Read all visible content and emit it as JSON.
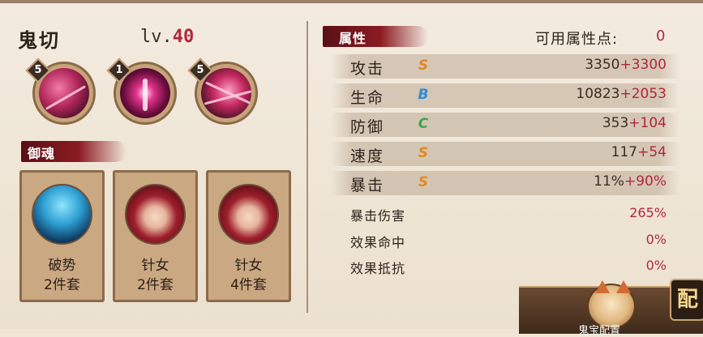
{
  "character": {
    "name": "鬼切",
    "level_prefix": "lv.",
    "level": "40"
  },
  "skills": [
    {
      "level": "5"
    },
    {
      "level": "1"
    },
    {
      "level": "5"
    }
  ],
  "yuhun": {
    "label": "御魂",
    "sets": [
      {
        "name": "破势",
        "count": "2件套"
      },
      {
        "name": "针女",
        "count": "2件套"
      },
      {
        "name": "针女",
        "count": "4件套"
      }
    ]
  },
  "attributes": {
    "label": "属性",
    "available_label": "可用属性点:",
    "available_value": "0",
    "rows": [
      {
        "name": "攻击",
        "grade": "S",
        "base": "3350",
        "bonus": "+3300"
      },
      {
        "name": "生命",
        "grade": "B",
        "base": "10823",
        "bonus": "+2053"
      },
      {
        "name": "防御",
        "grade": "C",
        "base": "353",
        "bonus": "+104"
      },
      {
        "name": "速度",
        "grade": "S",
        "base": "117",
        "bonus": "+54"
      },
      {
        "name": "暴击",
        "grade": "S",
        "base": "11%",
        "bonus": "+90%"
      }
    ],
    "extra_rows": [
      {
        "name": "暴击伤害",
        "value": "265%"
      },
      {
        "name": "效果命中",
        "value": "0%"
      },
      {
        "name": "效果抵抗",
        "value": "0%"
      }
    ]
  },
  "config": {
    "label": "鬼宝配置",
    "side_char": "配"
  },
  "colors": {
    "accent": "#b0283b",
    "brush": "#8c1b22",
    "grade_s": "#e08a1e",
    "grade_b": "#2c8cd6",
    "grade_c": "#3aa84a"
  }
}
